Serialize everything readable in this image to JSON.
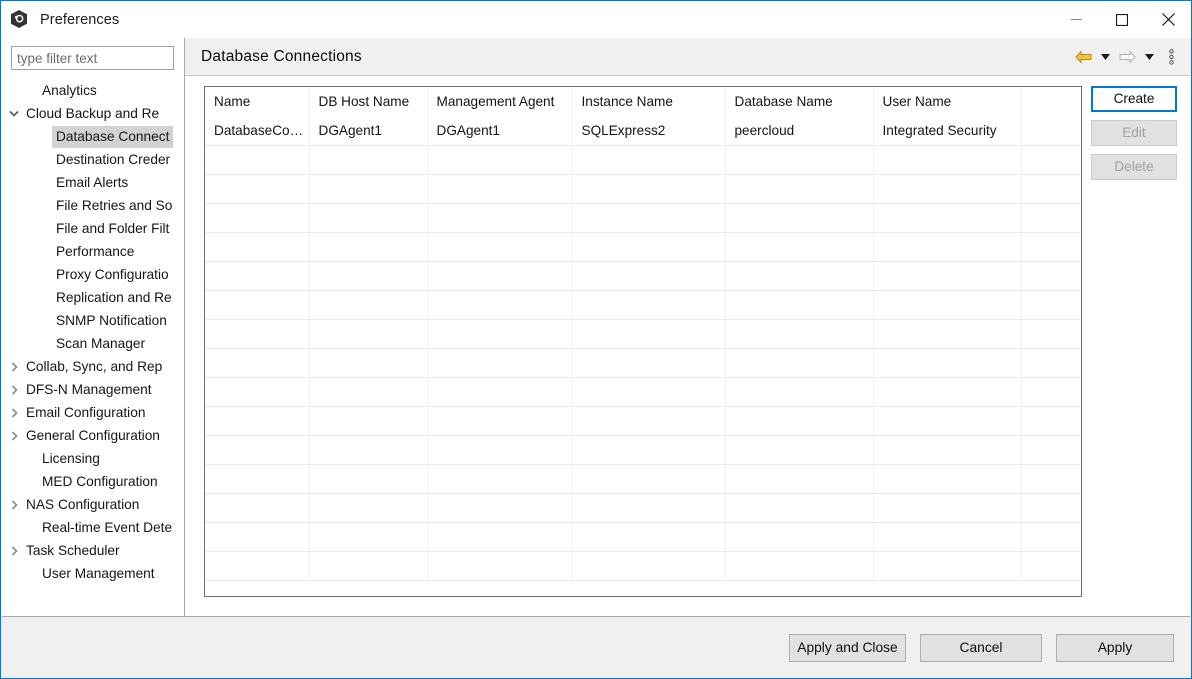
{
  "window": {
    "title": "Preferences",
    "app_icon": "hexagon-swirl-icon",
    "accent_color": "#0078d7",
    "controls": {
      "minimize": "minimize-icon",
      "maximize": "maximize-icon",
      "close": "close-icon"
    }
  },
  "sidebar": {
    "filter": {
      "value": "",
      "placeholder": "type filter text"
    },
    "items": [
      {
        "label": "Analytics",
        "indent": 1,
        "twisty": "none",
        "selected": false
      },
      {
        "label": "Cloud Backup and Re",
        "indent": 0,
        "twisty": "expanded",
        "selected": false
      },
      {
        "label": "Database Connect",
        "indent": 2,
        "twisty": "none",
        "selected": true
      },
      {
        "label": "Destination Creder",
        "indent": 2,
        "twisty": "none",
        "selected": false
      },
      {
        "label": "Email Alerts",
        "indent": 2,
        "twisty": "none",
        "selected": false
      },
      {
        "label": "File Retries and So",
        "indent": 2,
        "twisty": "none",
        "selected": false
      },
      {
        "label": "File and Folder Filt",
        "indent": 2,
        "twisty": "none",
        "selected": false
      },
      {
        "label": "Performance",
        "indent": 2,
        "twisty": "none",
        "selected": false
      },
      {
        "label": "Proxy Configuratio",
        "indent": 2,
        "twisty": "none",
        "selected": false
      },
      {
        "label": "Replication and Re",
        "indent": 2,
        "twisty": "none",
        "selected": false
      },
      {
        "label": "SNMP Notification",
        "indent": 2,
        "twisty": "none",
        "selected": false
      },
      {
        "label": "Scan Manager",
        "indent": 2,
        "twisty": "none",
        "selected": false
      },
      {
        "label": "Collab, Sync, and Rep",
        "indent": 0,
        "twisty": "collapsed",
        "selected": false
      },
      {
        "label": "DFS-N Management",
        "indent": 0,
        "twisty": "collapsed",
        "selected": false
      },
      {
        "label": "Email Configuration",
        "indent": 0,
        "twisty": "collapsed",
        "selected": false
      },
      {
        "label": "General Configuration",
        "indent": 0,
        "twisty": "collapsed",
        "selected": false
      },
      {
        "label": "Licensing",
        "indent": 1,
        "twisty": "none",
        "selected": false
      },
      {
        "label": "MED Configuration",
        "indent": 1,
        "twisty": "none",
        "selected": false
      },
      {
        "label": "NAS Configuration",
        "indent": 0,
        "twisty": "collapsed",
        "selected": false
      },
      {
        "label": "Real-time Event Dete",
        "indent": 1,
        "twisty": "none",
        "selected": false
      },
      {
        "label": "Task Scheduler",
        "indent": 0,
        "twisty": "collapsed",
        "selected": false
      },
      {
        "label": "User Management",
        "indent": 1,
        "twisty": "none",
        "selected": false
      }
    ],
    "scrollbar": {
      "left_arrow": "chevron-left-icon",
      "right_arrow": "chevron-right-icon"
    }
  },
  "page": {
    "title": "Database Connections",
    "toolbar": [
      {
        "name": "back-arrow-icon",
        "enabled": true
      },
      {
        "name": "back-dropdown-caret-icon",
        "enabled": true
      },
      {
        "name": "forward-arrow-icon",
        "enabled": false
      },
      {
        "name": "forward-dropdown-caret-icon",
        "enabled": true
      },
      {
        "name": "view-menu-icon",
        "enabled": true
      }
    ]
  },
  "table": {
    "columns": [
      "Name",
      "DB Host Name",
      "Management Agent",
      "Instance Name",
      "Database Name",
      "User Name",
      ""
    ],
    "rows": [
      {
        "name": "DatabaseCo…",
        "db_host_name": "DGAgent1",
        "management_agent": "DGAgent1",
        "instance_name": "SQLExpress2",
        "database_name": "peercloud",
        "user_name": "Integrated Security",
        "extra": ""
      }
    ],
    "empty_row_count": 15
  },
  "side_buttons": {
    "create": {
      "label": "Create",
      "enabled": true,
      "focused": true
    },
    "edit": {
      "label": "Edit",
      "enabled": false
    },
    "delete": {
      "label": "Delete",
      "enabled": false
    }
  },
  "footer": {
    "apply_and_close": "Apply and Close",
    "cancel": "Cancel",
    "apply": "Apply"
  }
}
